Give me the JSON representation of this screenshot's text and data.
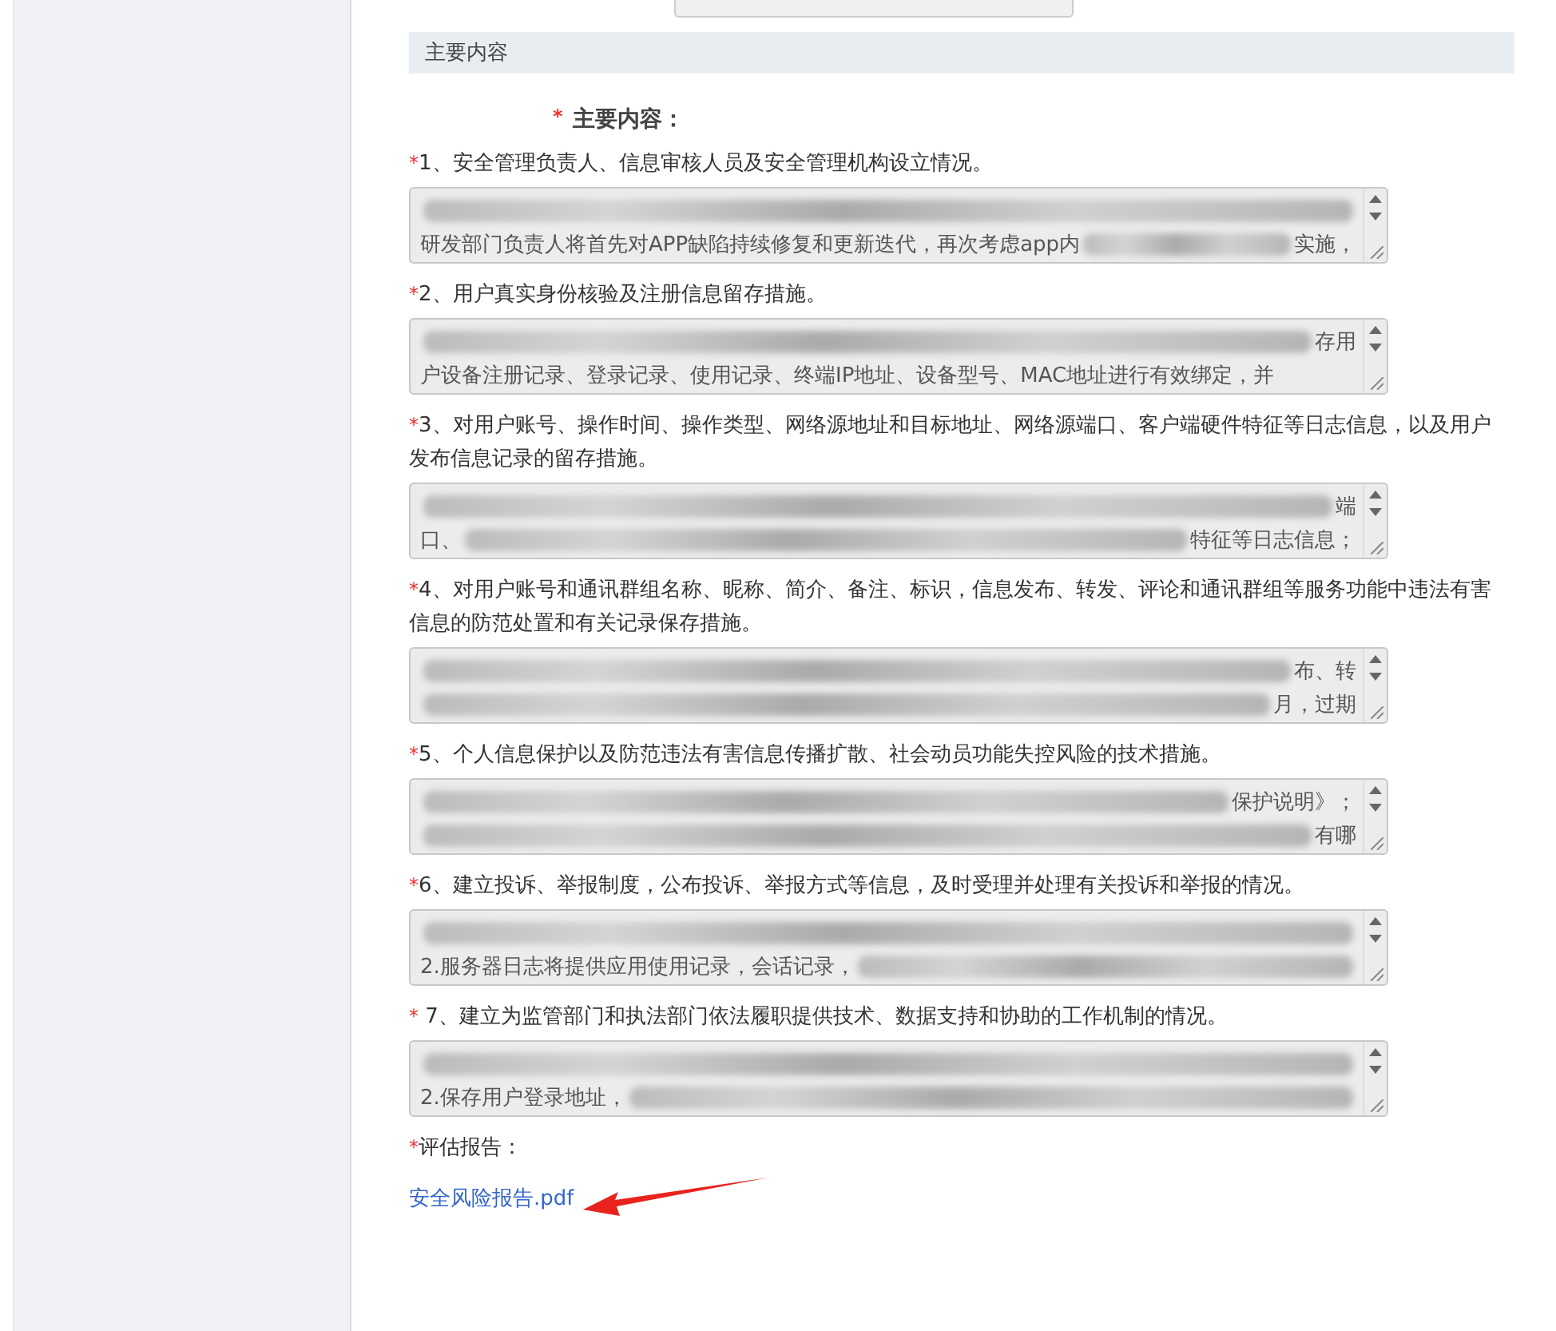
{
  "required_mark": "*",
  "section": {
    "title": "主要内容",
    "heading": "主要内容："
  },
  "questions": [
    {
      "label": "1、安全管理负责人、信息审核人员及安全管理机构设立情况。",
      "lines": [
        [
          {
            "kind": "redacted"
          }
        ],
        [
          {
            "kind": "text",
            "text": "研发部门负责人将首先对APP缺陷持续修复和更新迭代，再次考虑app内"
          },
          {
            "kind": "redacted"
          },
          {
            "kind": "text",
            "text": "实施，"
          }
        ]
      ]
    },
    {
      "label": "2、用户真实身份核验及注册信息留存措施。",
      "lines": [
        [
          {
            "kind": "redacted"
          },
          {
            "kind": "text",
            "text": "存用"
          }
        ],
        [
          {
            "kind": "text",
            "text": "户设备注册记录、登录记录、使用记录、终端IP地址、设备型号、MAC地址进行有效绑定，并"
          }
        ]
      ]
    },
    {
      "label": "3、对用户账号、操作时间、操作类型、网络源地址和目标地址、网络源端口、客户端硬件特征等日志信息，以及用户发布信息记录的留存措施。",
      "lines": [
        [
          {
            "kind": "redacted"
          },
          {
            "kind": "text",
            "text": "端"
          }
        ],
        [
          {
            "kind": "text",
            "text": "口、"
          },
          {
            "kind": "redacted"
          },
          {
            "kind": "text",
            "text": "特征等日志信息；"
          }
        ]
      ]
    },
    {
      "label": "4、对用户账号和通讯群组名称、昵称、简介、备注、标识，信息发布、转发、评论和通讯群组等服务功能中违法有害信息的防范处置和有关记录保存措施。",
      "lines": [
        [
          {
            "kind": "redacted"
          },
          {
            "kind": "text",
            "text": "布、转"
          }
        ],
        [
          {
            "kind": "redacted"
          },
          {
            "kind": "text",
            "text": "月，过期"
          }
        ]
      ]
    },
    {
      "label": "5、个人信息保护以及防范违法有害信息传播扩散、社会动员功能失控风险的技术措施。",
      "lines": [
        [
          {
            "kind": "redacted"
          },
          {
            "kind": "text",
            "text": "保护说明》；"
          }
        ],
        [
          {
            "kind": "redacted"
          },
          {
            "kind": "text",
            "text": "有哪"
          }
        ]
      ]
    },
    {
      "label": "6、建立投诉、举报制度，公布投诉、举报方式等信息，及时受理并处理有关投诉和举报的情况。",
      "lines": [
        [
          {
            "kind": "redacted"
          }
        ],
        [
          {
            "kind": "text",
            "text": "2.服务器日志将提供应用使用记录，会话记录，"
          },
          {
            "kind": "redacted"
          }
        ]
      ]
    },
    {
      "label": " 7、建立为监管部门和执法部门依法履职提供技术、数据支持和协助的工作机制的情况。",
      "lines": [
        [
          {
            "kind": "redacted"
          }
        ],
        [
          {
            "kind": "text",
            "text": "2.保存用户登录地址，"
          },
          {
            "kind": "redacted"
          }
        ]
      ]
    }
  ],
  "report": {
    "label": "评估报告：",
    "file": "安全风险报告.pdf"
  }
}
